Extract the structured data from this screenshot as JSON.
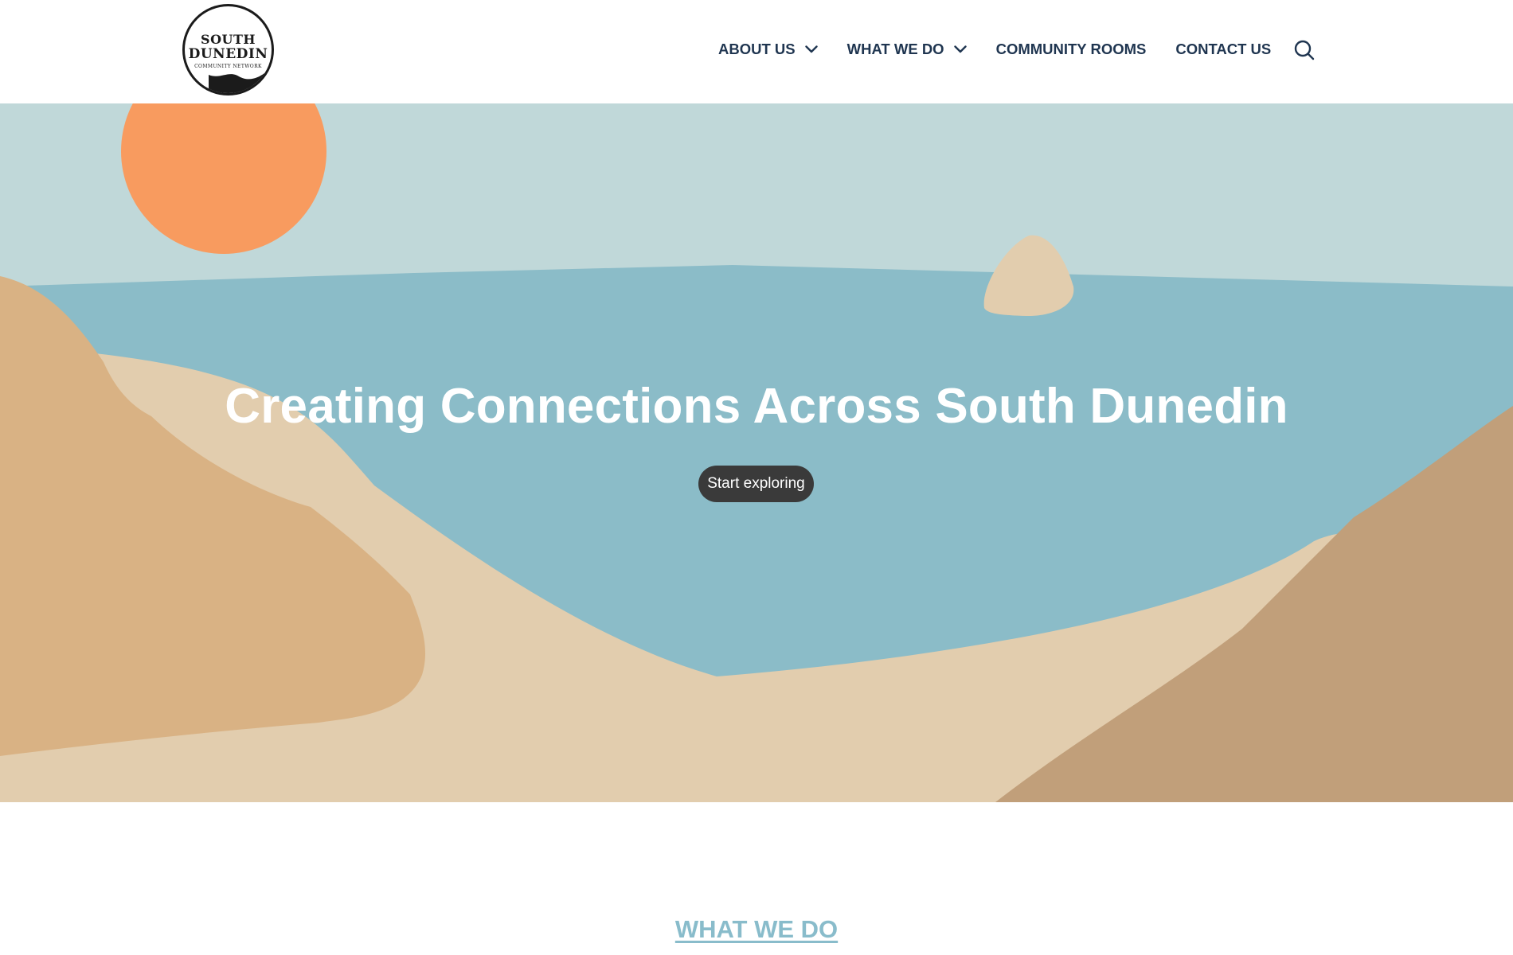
{
  "logo": {
    "line1": "SOUTH",
    "line2": "DUNEDIN",
    "line3": "COMMUNITY NETWORK"
  },
  "nav": {
    "items": [
      {
        "label": "ABOUT US",
        "has_dropdown": true
      },
      {
        "label": "WHAT WE DO",
        "has_dropdown": true
      },
      {
        "label": "COMMUNITY ROOMS",
        "has_dropdown": false
      },
      {
        "label": "CONTACT US",
        "has_dropdown": false
      }
    ],
    "search_icon": "search-icon",
    "dropdown_icon": "chevron-down-icon"
  },
  "hero": {
    "title": "Creating Connections Across South Dunedin",
    "cta_label": "Start exploring"
  },
  "section": {
    "title": "WHAT WE DO"
  },
  "colors": {
    "nav_text": "#1f3550",
    "sky": "#c0d8d9",
    "sea": "#8bbcc8",
    "sun": "#f89b5f",
    "sand": "#e2cdae",
    "hill_left": "#d9b284",
    "hill_right": "#c19f7a",
    "button": "#3a3a3a",
    "section_title": "#89bccb"
  }
}
